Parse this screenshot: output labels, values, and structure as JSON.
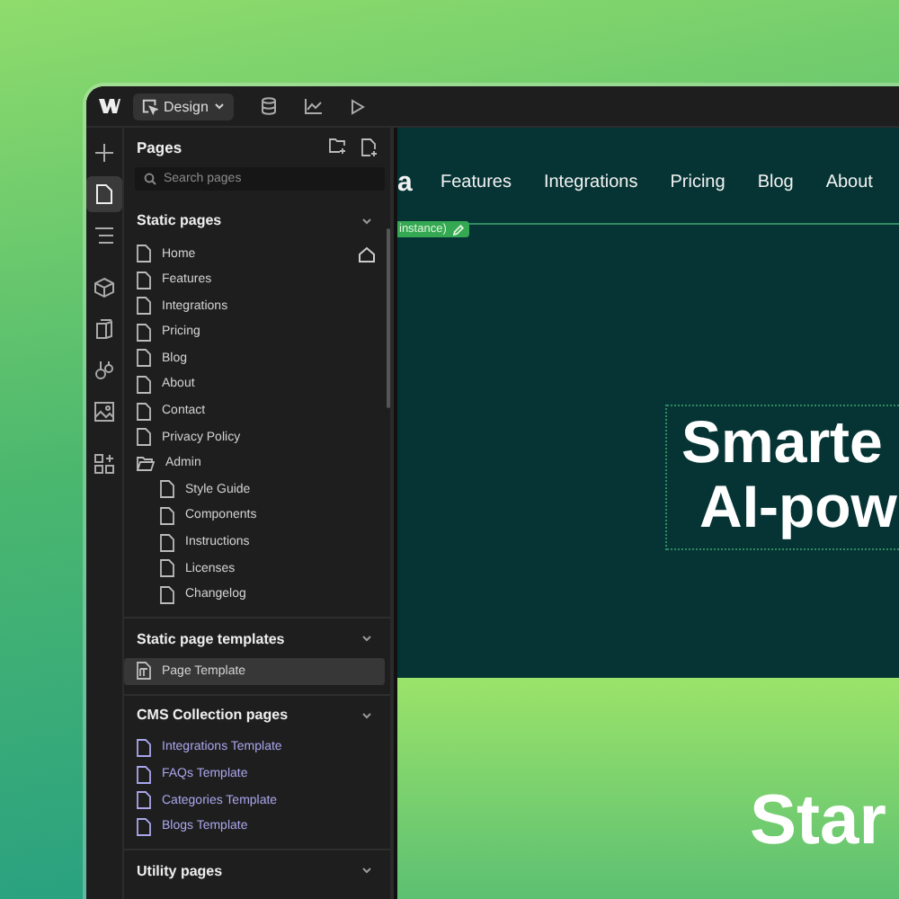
{
  "toolbar": {
    "mode_button": "Design"
  },
  "rail": [
    {
      "kind": "add",
      "selected": false
    },
    {
      "kind": "pages",
      "selected": true
    },
    {
      "kind": "navigator",
      "selected": false
    },
    {
      "kind": "components",
      "selected": false
    },
    {
      "kind": "styles",
      "selected": false
    },
    {
      "kind": "variables",
      "selected": false
    },
    {
      "kind": "assets",
      "selected": false
    },
    {
      "kind": "apps",
      "selected": false
    }
  ],
  "pages_panel": {
    "title": "Pages",
    "search": {
      "placeholder": "Search pages"
    },
    "sections": [
      {
        "title": "Static pages",
        "expanded": true,
        "items": [
          {
            "label": "Home",
            "kind": "page",
            "selected": false,
            "home": true
          },
          {
            "label": "Features",
            "kind": "page",
            "selected": false,
            "home": false
          },
          {
            "label": "Integrations",
            "kind": "page",
            "selected": false,
            "home": false
          },
          {
            "label": "Pricing",
            "kind": "page",
            "selected": false,
            "home": false
          },
          {
            "label": "Blog",
            "kind": "page",
            "selected": false,
            "home": false
          },
          {
            "label": "About",
            "kind": "page",
            "selected": false,
            "home": false
          },
          {
            "label": "Contact",
            "kind": "page",
            "selected": false,
            "home": false
          },
          {
            "label": "Privacy Policy",
            "kind": "page",
            "selected": false,
            "home": false
          },
          {
            "label": "Admin",
            "kind": "folder",
            "selected": false,
            "home": false,
            "children": [
              {
                "label": "Style Guide",
                "kind": "page",
                "selected": false,
                "home": false
              },
              {
                "label": "Components",
                "kind": "page",
                "selected": false,
                "home": false
              },
              {
                "label": "Instructions",
                "kind": "page",
                "selected": false,
                "home": false
              },
              {
                "label": "Licenses",
                "kind": "page",
                "selected": false,
                "home": false
              },
              {
                "label": "Changelog",
                "kind": "page",
                "selected": false,
                "home": false
              }
            ]
          }
        ]
      },
      {
        "title": "Static page templates",
        "expanded": true,
        "items": [
          {
            "label": "Page Template",
            "kind": "template",
            "selected": true,
            "home": false
          }
        ]
      },
      {
        "title": "CMS Collection pages",
        "expanded": true,
        "items": [
          {
            "label": "Integrations Template",
            "kind": "cms",
            "selected": false,
            "home": false
          },
          {
            "label": "FAQs Template",
            "kind": "cms",
            "selected": false,
            "home": false
          },
          {
            "label": "Categories Template",
            "kind": "cms",
            "selected": false,
            "home": false
          },
          {
            "label": "Blogs Template",
            "kind": "cms",
            "selected": false,
            "home": false
          }
        ]
      },
      {
        "title": "Utility pages",
        "expanded": true
      }
    ]
  },
  "canvas": {
    "logo_text": "a",
    "nav": [
      "Features",
      "Integrations",
      "Pricing",
      "Blog",
      "About"
    ],
    "element_tag": "instance)",
    "hero_lines": [
      "Smarte",
      "AI-pow"
    ],
    "next_heading": "Star"
  }
}
